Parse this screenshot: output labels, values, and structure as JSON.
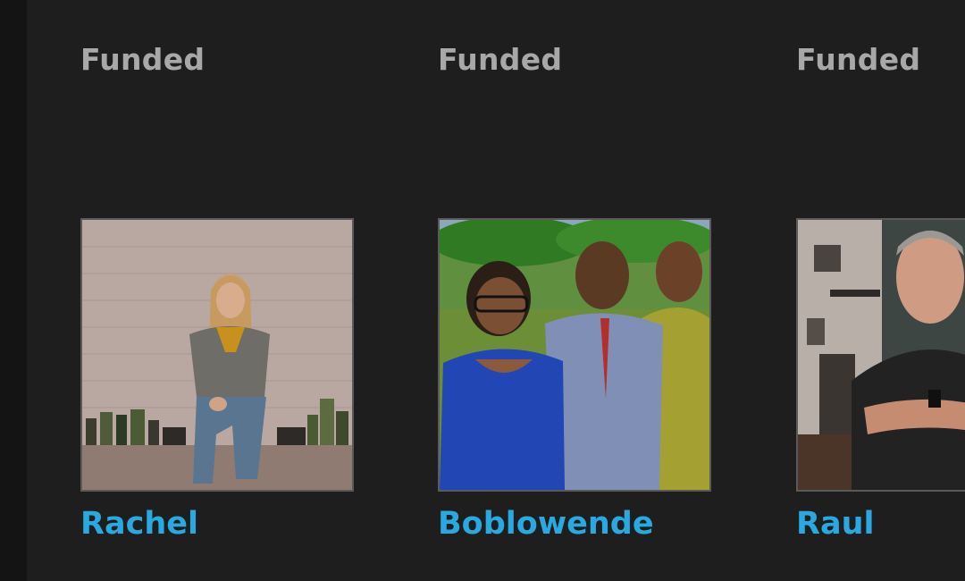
{
  "campaigns": [
    {
      "status": "Funded",
      "name": "Rachel",
      "photo_icon": "person-photo"
    },
    {
      "status": "Funded",
      "name": "Boblowende",
      "photo_icon": "group-photo"
    },
    {
      "status": "Funded",
      "name": "Raul",
      "photo_icon": "person-photo"
    }
  ],
  "colors": {
    "background": "#1e1e1e",
    "status_text": "#a8a8a8",
    "name_link": "#29a9e0",
    "photo_border": "#5a5a5a"
  }
}
